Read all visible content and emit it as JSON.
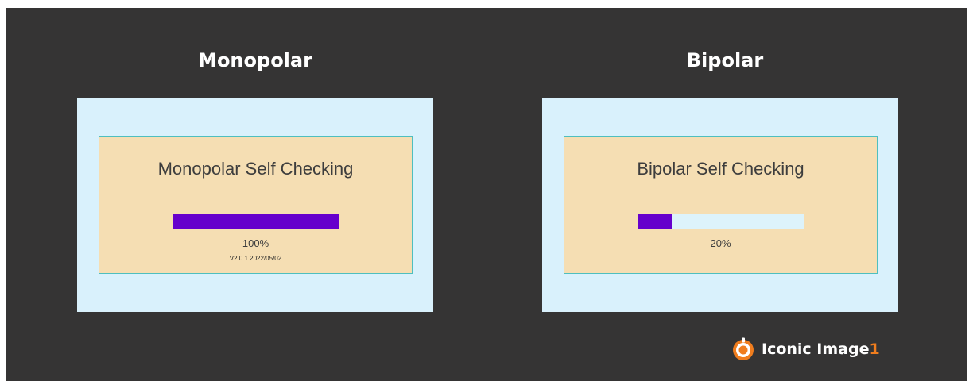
{
  "monopolar": {
    "heading": "Monopolar",
    "dialog_title": "Monopolar Self Checking",
    "progress": 1.0,
    "progress_label": "100%",
    "version": "V2.0.1  2022/05/02"
  },
  "bipolar": {
    "heading": "Bipolar",
    "dialog_title": "Bipolar Self Checking",
    "progress": 0.2,
    "progress_label": "20%"
  },
  "brand": {
    "name": "Iconic Image",
    "accent": "1",
    "logo_icon": "orange-ring-logo-icon"
  },
  "colors": {
    "background": "#353434",
    "panel": "#d9f1fc",
    "dialog": "#f5deb3",
    "dialog_border": "#4ebfbf",
    "progress_fill": "#6600cc",
    "brand_accent": "#f07d1e"
  }
}
